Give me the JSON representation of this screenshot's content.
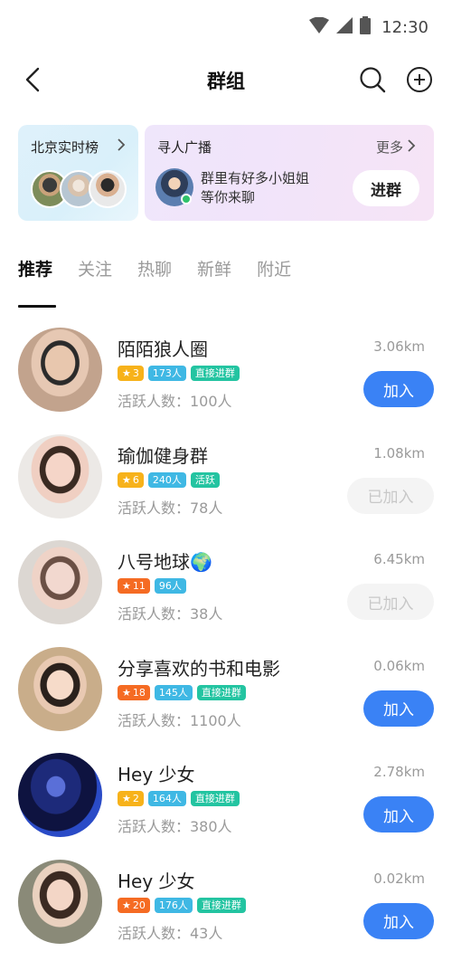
{
  "status": {
    "time": "12:30"
  },
  "header": {
    "title": "群组"
  },
  "rank_card": {
    "label": "北京实时榜"
  },
  "broadcast": {
    "label": "寻人广播",
    "more": "更多",
    "text_line1": "群里有好多小姐姐",
    "text_line2": "等你来聊",
    "join_label": "进群"
  },
  "tabs": [
    {
      "label": "推荐"
    },
    {
      "label": "关注"
    },
    {
      "label": "热聊"
    },
    {
      "label": "新鲜"
    },
    {
      "label": "附近"
    }
  ],
  "groups": [
    {
      "name": "陌陌狼人圈",
      "level": "3",
      "members": "173人",
      "tag": "直接进群",
      "active": "活跃人数：100人",
      "distance": "3.06km",
      "action": "加入",
      "joined": false
    },
    {
      "name": "瑜伽健身群",
      "level": "6",
      "members": "240人",
      "tag": "活跃",
      "active": "活跃人数：78人",
      "distance": "1.08km",
      "action": "已加入",
      "joined": true
    },
    {
      "name": "八号地球🌍",
      "level": "11",
      "members": "96人",
      "tag": "",
      "active": "活跃人数：38人",
      "distance": "6.45km",
      "action": "已加入",
      "joined": true
    },
    {
      "name": "分享喜欢的书和电影",
      "level": "18",
      "members": "145人",
      "tag": "直接进群",
      "active": "活跃人数：1100人",
      "distance": "0.06km",
      "action": "加入",
      "joined": false
    },
    {
      "name": "Hey 少女",
      "level": "2",
      "members": "164人",
      "tag": "直接进群",
      "active": "活跃人数：380人",
      "distance": "2.78km",
      "action": "加入",
      "joined": false
    },
    {
      "name": "Hey 少女",
      "level": "20",
      "members": "176人",
      "tag": "直接进群",
      "active": "活跃人数：43人",
      "distance": "0.02km",
      "action": "加入",
      "joined": false
    }
  ],
  "colors": {
    "accent": "#3a82f5",
    "level_badge": "#f7b21a",
    "level_badge_high": "#f56b23",
    "count_badge": "#3fb8e4",
    "tag_badge": "#23c4a1"
  }
}
